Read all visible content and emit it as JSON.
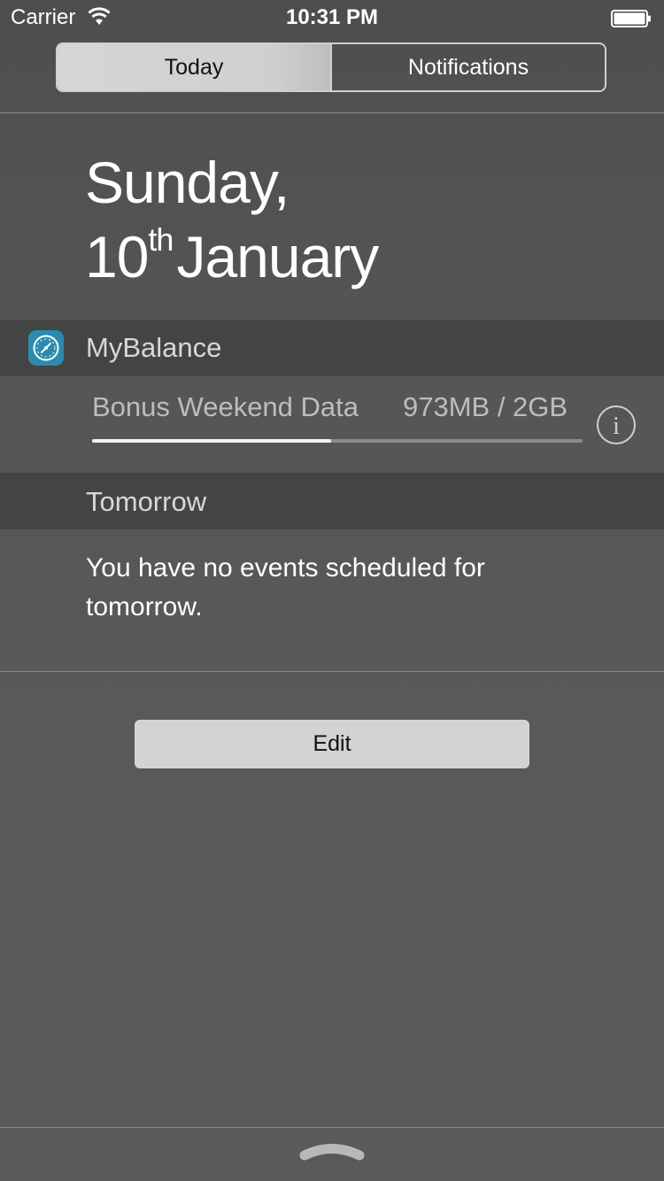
{
  "status_bar": {
    "carrier": "Carrier",
    "time": "10:31 PM",
    "wifi_icon": "wifi-icon",
    "battery_icon": "battery-icon"
  },
  "segmented_control": {
    "selected": "Today",
    "tabs": [
      {
        "label": "Today"
      },
      {
        "label": "Notifications"
      }
    ]
  },
  "date": {
    "line1": "Sunday,",
    "day": "10",
    "suffix": "th",
    "month": "January"
  },
  "widgets": {
    "mybalance": {
      "title": "MyBalance",
      "icon": "speedometer-icon",
      "label": "Bonus Weekend Data",
      "value": "973MB / 2GB",
      "progress_fraction": 0.487,
      "info_icon": "info-icon"
    },
    "tomorrow": {
      "title": "Tomorrow",
      "message": "You have no events scheduled for tomorrow."
    }
  },
  "footer": {
    "edit_label": "Edit",
    "grabber_icon": "chevron-up-icon"
  },
  "colors": {
    "accent_icon": "#2a8bb0",
    "segment_selected": "#d3d3d3",
    "edit_button": "#d3d3d3"
  }
}
